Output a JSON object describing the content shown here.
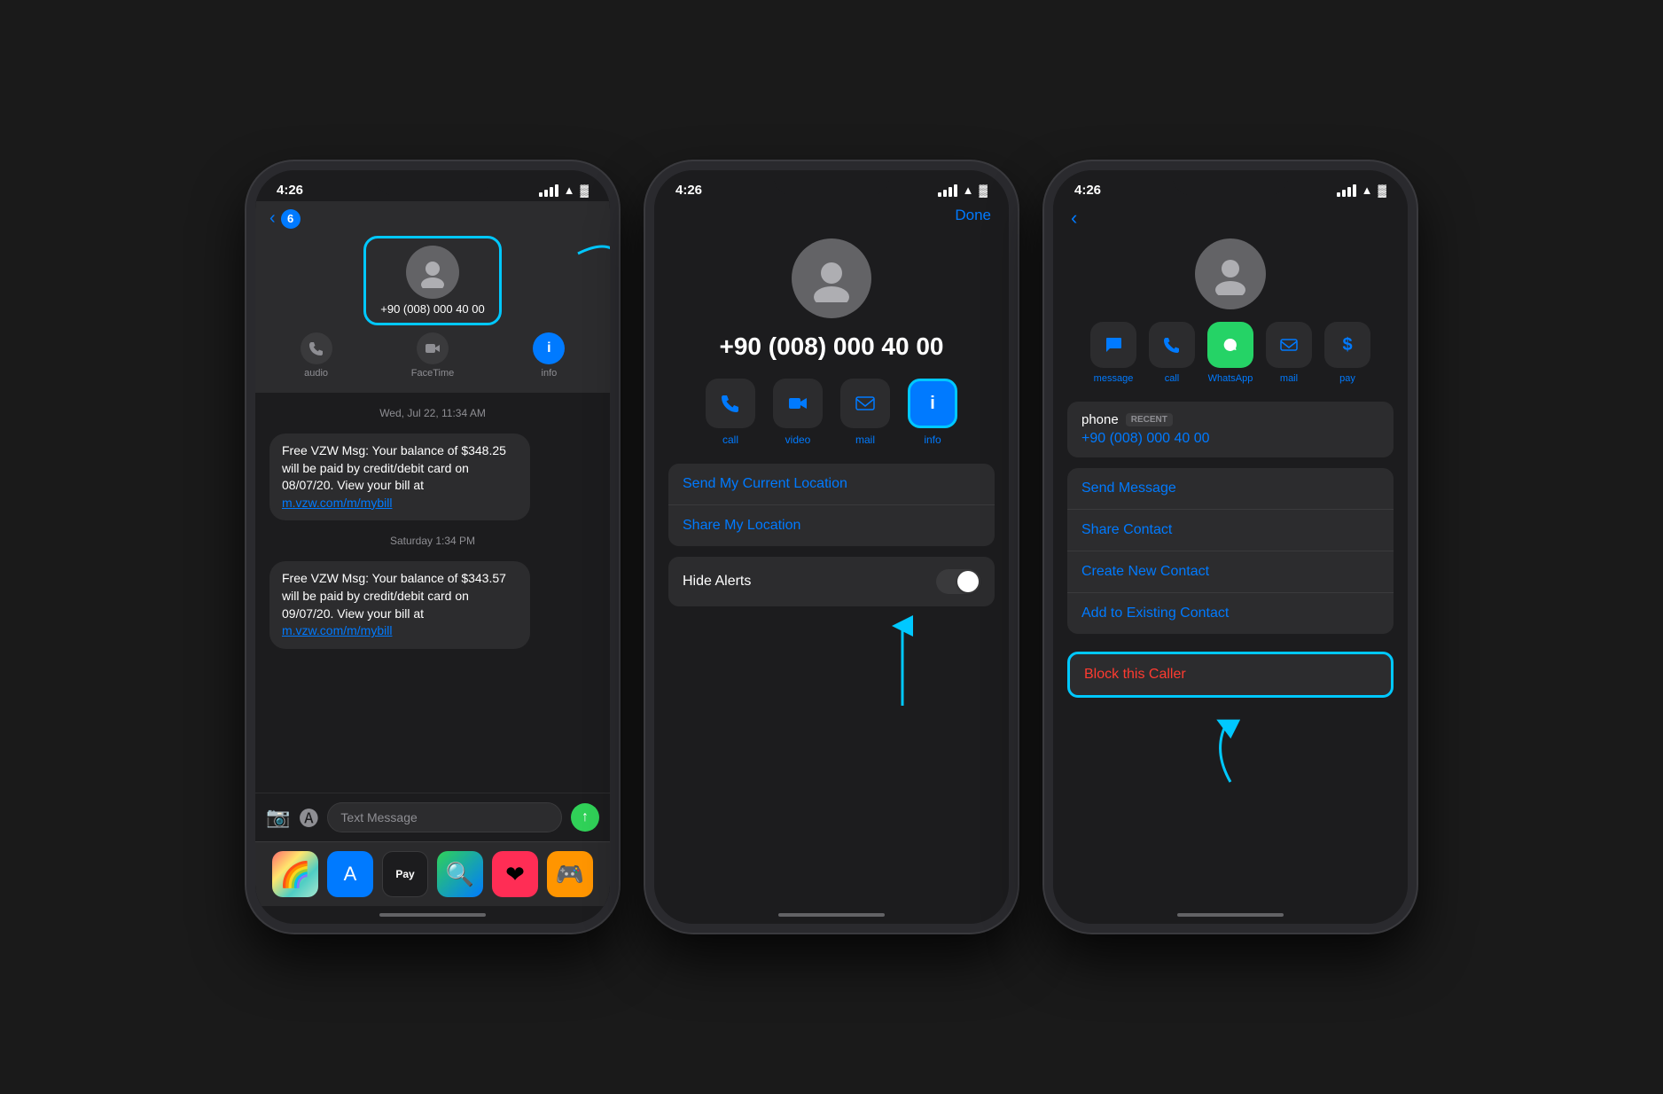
{
  "phones": {
    "phone1": {
      "status_time": "4:26",
      "contact_name": "+90 (008) 000 40 00",
      "back_count": "6",
      "actions": [
        {
          "icon": "📞",
          "label": "audio"
        },
        {
          "icon": "📹",
          "label": "FaceTime"
        },
        {
          "icon": "ℹ",
          "label": "info"
        }
      ],
      "message_date1": "Wed, Jul 22, 11:34 AM",
      "message_text1": "Free VZW Msg: Your balance of $348.25 will be paid by credit/debit card on 08/07/20. View your bill at m.vzw.com/m/mybill",
      "message_date2": "Saturday 1:34 PM",
      "message_text2": "Free VZW Msg: Your balance of $343.57 will be paid by credit/debit card on 09/07/20. View your bill at m.vzw.com/m/mybill",
      "message_link1": "m.vzw.com/m/mybill",
      "message_link2": "m.vzw.com/m/mybill",
      "text_message_placeholder": "Text Message",
      "message_label": "Text Message"
    },
    "phone2": {
      "status_time": "4:26",
      "phone_number": "+90 (008) 000 40 00",
      "done_label": "Done",
      "actions": [
        {
          "icon": "📞",
          "label": "call"
        },
        {
          "icon": "📹",
          "label": "video"
        },
        {
          "icon": "✉",
          "label": "mail"
        },
        {
          "icon": "ℹ",
          "label": "info"
        }
      ],
      "send_location": "Send My Current Location",
      "share_location": "Share My Location",
      "hide_alerts": "Hide Alerts"
    },
    "phone3": {
      "status_time": "4:26",
      "actions": [
        {
          "icon": "💬",
          "label": "message"
        },
        {
          "icon": "📞",
          "label": "call"
        },
        {
          "icon": "📱",
          "label": "WhatsApp"
        },
        {
          "icon": "✉",
          "label": "mail"
        },
        {
          "icon": "$",
          "label": "pay"
        }
      ],
      "phone_label": "phone",
      "recent_badge": "RECENT",
      "phone_number": "+90 (008) 000 40 00",
      "action_send": "Send Message",
      "action_share": "Share Contact",
      "action_create": "Create New Contact",
      "action_add": "Add to Existing Contact",
      "block_caller": "Block this Caller"
    }
  }
}
